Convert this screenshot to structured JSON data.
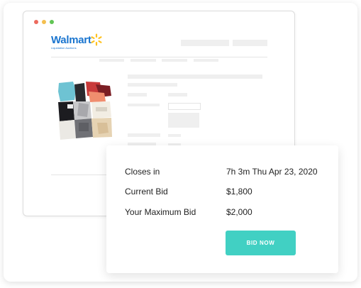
{
  "browser": {
    "logo": {
      "brand": "Walmart",
      "subtitle": "Liquidation Auctions",
      "spark_color": "#ffc220",
      "brand_color": "#1a75cf",
      "icon": "walmart-spark-icon"
    },
    "window_controls": [
      "close-dot",
      "minimize-dot",
      "maximize-dot"
    ]
  },
  "auction": {
    "rows": [
      {
        "label": "Closes in",
        "value": "7h 3m Thu Apr 23, 2020"
      },
      {
        "label": "Current Bid",
        "value": "$1,800"
      },
      {
        "label": "Your Maximum Bid",
        "value": "$2,000"
      }
    ],
    "bid_button": "BID NOW",
    "accent_color": "#41d0c3"
  }
}
